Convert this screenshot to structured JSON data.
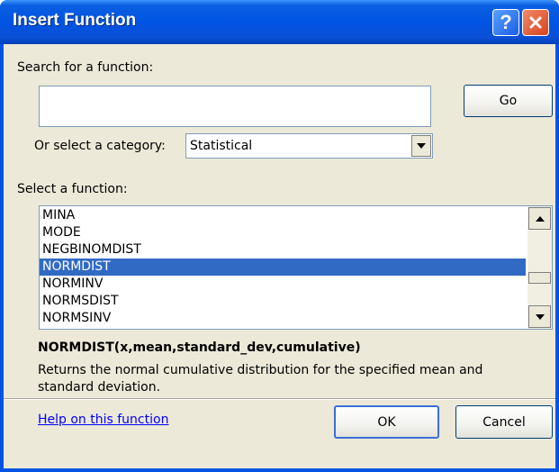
{
  "window": {
    "title": "Insert Function",
    "help_glyph": "?",
    "title_color": "#0054e3"
  },
  "search": {
    "label": "Search for a function:",
    "value": "",
    "go_label": "Go"
  },
  "category": {
    "label": "Or select a category:",
    "selected": "Statistical"
  },
  "functions": {
    "label": "Select a function:",
    "items": [
      "MINA",
      "MODE",
      "NEGBINOMDIST",
      "NORMDIST",
      "NORMINV",
      "NORMSDIST",
      "NORMSINV"
    ],
    "selected_index": 3,
    "selected_color": "#316ac5"
  },
  "details": {
    "signature": "NORMDIST(x,mean,standard_dev,cumulative)",
    "description": "Returns the normal cumulative distribution for the specified mean and standard deviation."
  },
  "footer": {
    "help_link": "Help on this function",
    "ok_label": "OK",
    "cancel_label": "Cancel"
  },
  "icons": {
    "close": "close-icon",
    "help": "help-icon",
    "dropdown": "chevron-down-icon",
    "scroll_up": "scroll-up-icon",
    "scroll_down": "scroll-down-icon"
  }
}
